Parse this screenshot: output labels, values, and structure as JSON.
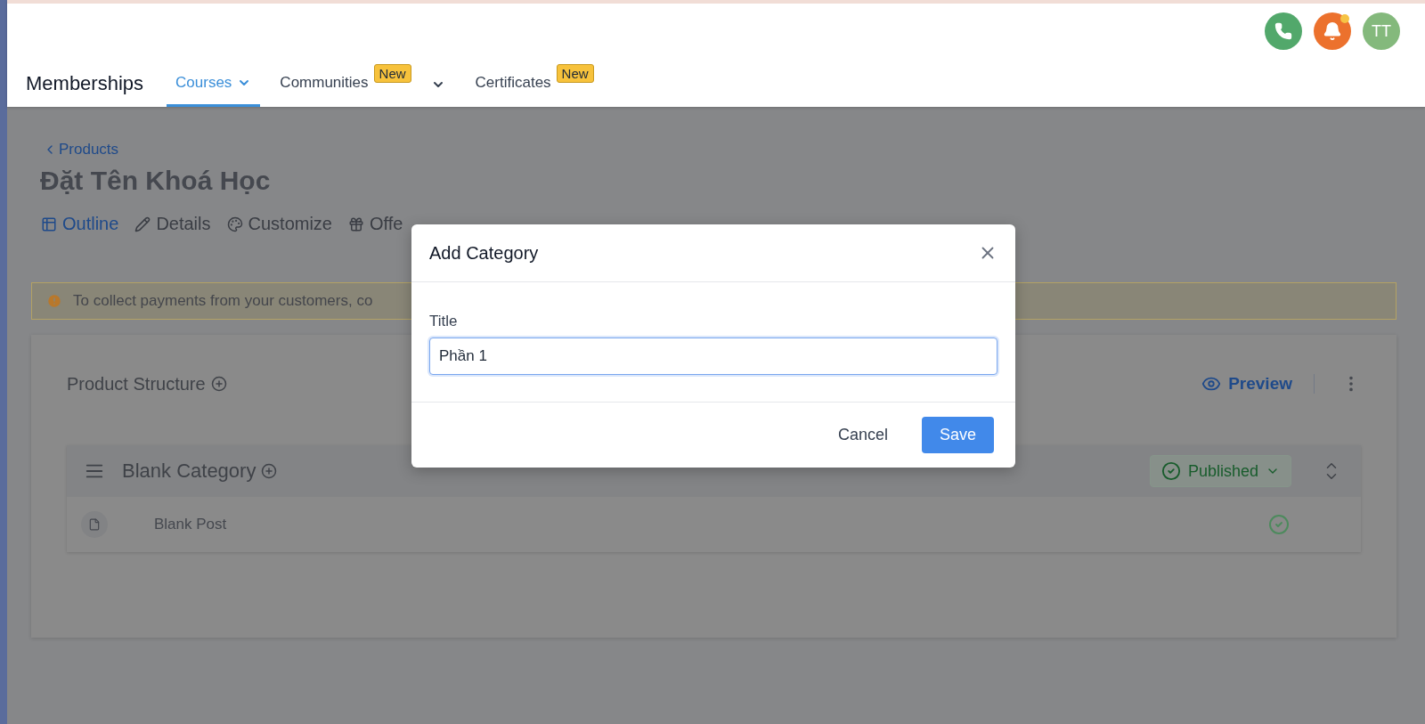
{
  "header": {
    "title": "Memberships",
    "nav": [
      {
        "label": "Courses",
        "selected": true,
        "kind": "dropdown"
      },
      {
        "label": "Communities",
        "badge": "New",
        "selected": false,
        "kind": "split"
      },
      {
        "label": "Certificates",
        "badge": "New",
        "selected": false,
        "kind": "link"
      }
    ],
    "actions": [
      {
        "kind": "phone",
        "color": "#52a86b"
      },
      {
        "kind": "bell",
        "color": "#ec712d",
        "unread": true
      },
      {
        "kind": "avatar",
        "color": "#84b97c",
        "initials": "TT"
      }
    ]
  },
  "page": {
    "breadcrumb": "Products",
    "title": "Đặt Tên Khoá Học",
    "tabs": [
      {
        "label": "Outline",
        "selected": true
      },
      {
        "label": "Details",
        "selected": false
      },
      {
        "label": "Customize",
        "selected": false
      },
      {
        "label": "Offe",
        "selected": false
      }
    ]
  },
  "alert": "To collect payments from your customers, co",
  "structure": {
    "title": "Product Structure",
    "preview": "Preview",
    "categories": [
      {
        "title": "Blank Category",
        "status": "Published",
        "posts": [
          {
            "title": "Blank Post",
            "published": true
          }
        ]
      }
    ]
  },
  "dialog": {
    "title": "Add Category",
    "field_label": "Title",
    "field_value": "Phần 1",
    "cancel": "Cancel",
    "save": "Save"
  }
}
